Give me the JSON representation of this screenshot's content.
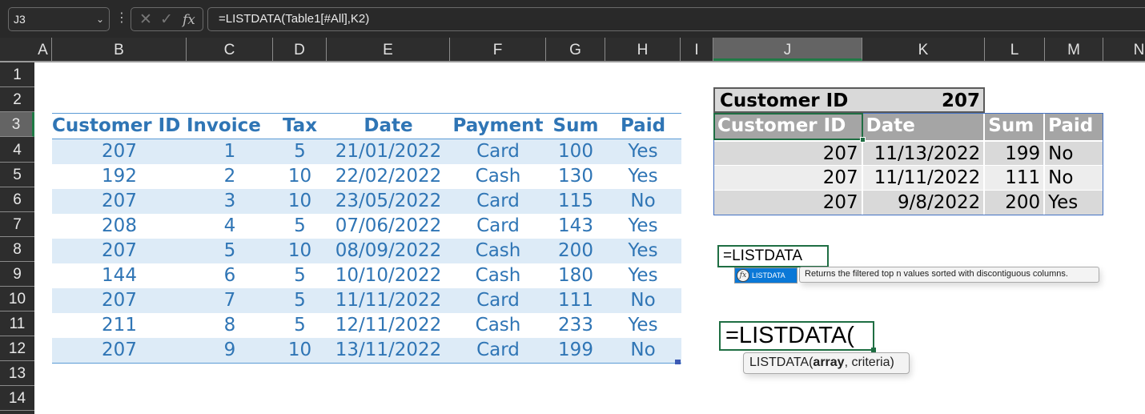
{
  "formula_bar": {
    "name_box": "J3",
    "cancel_icon": "✕",
    "enter_icon": "✓",
    "fx_label": "fx",
    "formula": "=LISTDATA(Table1[#All],K2)"
  },
  "columns": [
    "A",
    "B",
    "C",
    "D",
    "E",
    "F",
    "G",
    "H",
    "I",
    "J",
    "K",
    "L",
    "M",
    "N"
  ],
  "selected_column": "J",
  "rows": [
    "1",
    "2",
    "3",
    "4",
    "5",
    "6",
    "7",
    "8",
    "9",
    "10",
    "11",
    "12",
    "13",
    "14"
  ],
  "selected_row": "3",
  "table1": {
    "headers": [
      "Customer ID",
      "Invoice",
      "Tax",
      "Date",
      "Payment",
      "Sum",
      "Paid"
    ],
    "rows": [
      [
        "207",
        "1",
        "5",
        "21/01/2022",
        "Card",
        "100",
        "Yes"
      ],
      [
        "192",
        "2",
        "10",
        "22/02/2022",
        "Cash",
        "130",
        "Yes"
      ],
      [
        "207",
        "3",
        "10",
        "23/05/2022",
        "Card",
        "115",
        "No"
      ],
      [
        "208",
        "4",
        "5",
        "07/06/2022",
        "Card",
        "143",
        "Yes"
      ],
      [
        "207",
        "5",
        "10",
        "08/09/2022",
        "Cash",
        "200",
        "Yes"
      ],
      [
        "144",
        "6",
        "5",
        "10/10/2022",
        "Cash",
        "180",
        "Yes"
      ],
      [
        "207",
        "7",
        "5",
        "11/11/2022",
        "Card",
        "111",
        "No"
      ],
      [
        "211",
        "8",
        "5",
        "12/11/2022",
        "Cash",
        "233",
        "Yes"
      ],
      [
        "207",
        "9",
        "10",
        "13/11/2022",
        "Card",
        "199",
        "No"
      ]
    ]
  },
  "criteria": {
    "label": "Customer ID",
    "value": "207"
  },
  "result_table": {
    "headers": [
      "Customer ID",
      "Date",
      "Sum",
      "Paid"
    ],
    "rows": [
      [
        "207",
        "11/13/2022",
        "199",
        "No"
      ],
      [
        "207",
        "11/11/2022",
        "111",
        "No"
      ],
      [
        "207",
        "9/8/2022",
        "200",
        "Yes"
      ]
    ]
  },
  "autocomplete": {
    "typed": "=LISTDATA",
    "item_icon": "fx",
    "item_label": "LISTDATA",
    "description": "Returns the filtered top n values sorted with discontiguous columns."
  },
  "arg_hint": {
    "typed": "=LISTDATA(",
    "fn_name": "LISTDATA(",
    "arg_bold": "array",
    "rest": ", criteria)"
  },
  "colors": {
    "table_blue": "#2f75b5",
    "band_blue": "#ddebf7",
    "selection_green": "#1f6e43",
    "result_header": "#a5a5a5"
  }
}
